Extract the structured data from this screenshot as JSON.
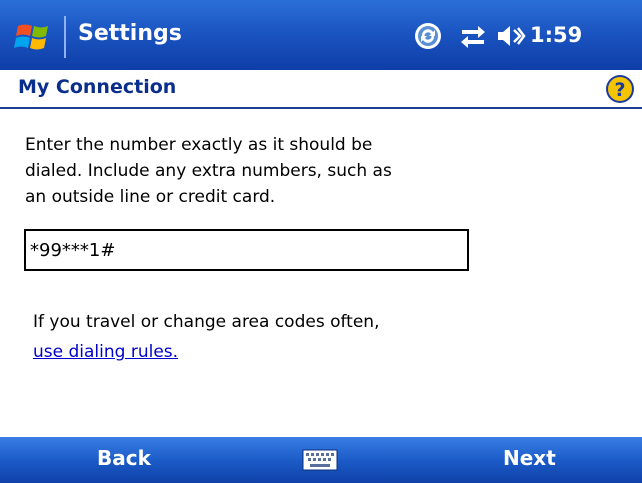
{
  "titlebar": {
    "app_title": "Settings",
    "time": "1:59",
    "icons": [
      "windows-start-icon",
      "sync-icon",
      "connectivity-icon",
      "speaker-icon"
    ]
  },
  "header": {
    "page_title": "My Connection",
    "help_icon": "help-icon"
  },
  "main": {
    "instructions": "Enter the number exactly as it should be\ndialed.  Include any extra numbers, such as\nan outside line or credit card.",
    "phone_number": "*99***1#",
    "travel_text": "If you travel or change area codes often,",
    "dialing_rules_link": "use dialing rules."
  },
  "menubar": {
    "left_softkey": "Back",
    "right_softkey": "Next",
    "keyboard_icon": "keyboard-icon"
  },
  "colors": {
    "titlebar": "#1b55c2",
    "header_text": "#0a2e8c",
    "link": "#0000cc",
    "menubar": "#1c5cc8"
  }
}
